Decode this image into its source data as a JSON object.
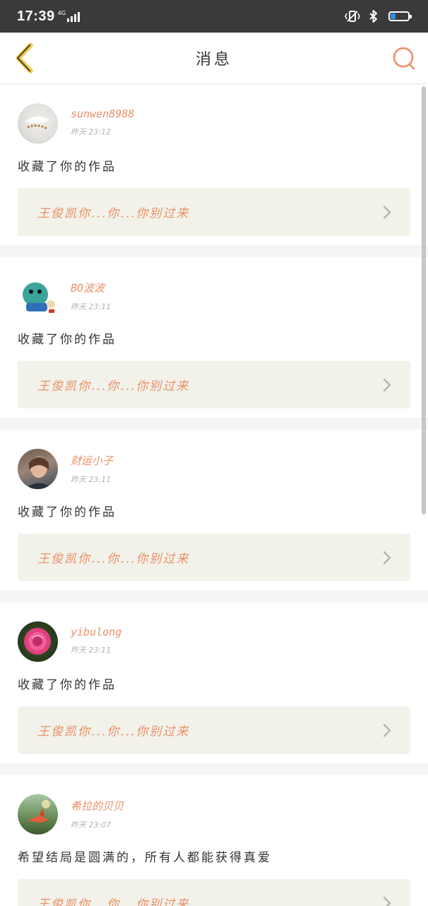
{
  "status_bar": {
    "time": "17:39",
    "network": "4G",
    "battery_level": 0.3,
    "battery_color": "#2e8ff0"
  },
  "header": {
    "title": "消息",
    "back_icon": "chevron-left-icon",
    "search_icon": "search-icon",
    "accent": "#e99068"
  },
  "messages": [
    {
      "username": "sunwen8988",
      "time": "昨天 23:12",
      "action": "收藏了你的作品",
      "work_title": "王俊凯你...你...你别过来"
    },
    {
      "username": "BO波波",
      "time": "昨天 23:11",
      "action": "收藏了你的作品",
      "work_title": "王俊凯你...你...你别过来"
    },
    {
      "username": "财运小子",
      "time": "昨天 23:11",
      "action": "收藏了你的作品",
      "work_title": "王俊凯你...你...你别过来"
    },
    {
      "username": "yibulong",
      "time": "昨天 23:11",
      "action": "收藏了你的作品",
      "work_title": "王俊凯你...你...你别过来"
    },
    {
      "username": "希拉的贝贝",
      "time": "昨天 23:07",
      "action": "希望结局是圆满的，所有人都能获得真爱",
      "work_title": "王俊凯你...你...你别过来"
    }
  ]
}
